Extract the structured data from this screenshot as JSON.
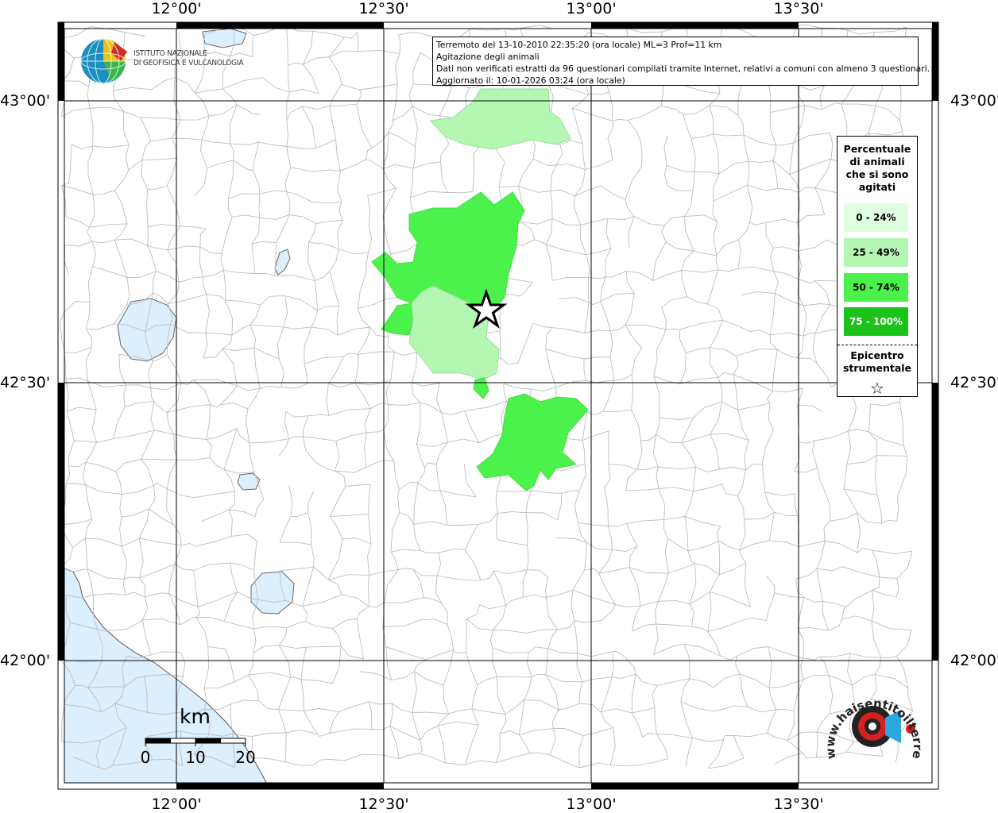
{
  "info": {
    "line1": "Terremoto del 13-10-2010 22:35:20 (ora locale) ML=3 Prof=11 km",
    "line2": "Agitazione degli animali",
    "line3": "Dati non verificati estratti da 96 questionari compilati tramite Internet, relativi a comuni con almeno 3 questionari.",
    "line4": "Aggiornato il: 10-01-2026 03:24 (ora locale)"
  },
  "logo": {
    "line1": "ISTITUTO NAZIONALE",
    "line2": "DI GEOFISICA E VULCANOLOGIA"
  },
  "axes": {
    "lon_labels": [
      "12°00'",
      "12°30'",
      "13°00'",
      "13°30'"
    ],
    "lat_labels": [
      "43°00'",
      "42°30'",
      "42°00'"
    ]
  },
  "legend": {
    "title_l1": "Percentuale",
    "title_l2": "di animali",
    "title_l3": "che si sono",
    "title_l4": "agitati",
    "classes": [
      {
        "label": "0 - 24%",
        "color": "#e0ffe0"
      },
      {
        "label": "25 - 49%",
        "color": "#b3f7b3"
      },
      {
        "label": "50 - 74%",
        "color": "#4cf24c"
      },
      {
        "label": "75 - 100%",
        "color": "#1ac21a"
      }
    ],
    "epi_l1": "Epicentro",
    "epi_l2": "strumentale",
    "epi_symbol": "☆"
  },
  "scale": {
    "unit": "km",
    "ticks": [
      "0",
      "10",
      "20"
    ]
  },
  "branding": {
    "text": "www.haisentitoilterremoto.it"
  },
  "colors": {
    "sea": "#dcefff",
    "borders": "#bbbbbb",
    "grid": "#000000"
  }
}
